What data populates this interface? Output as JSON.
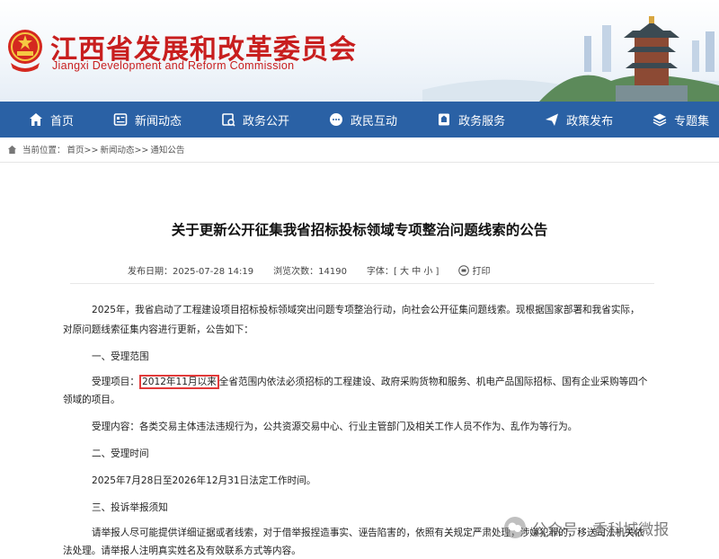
{
  "header": {
    "title": "江西省发展和改革委员会",
    "subtitle": "Jiangxi Development and Reform Commission"
  },
  "nav": [
    {
      "label": "首页",
      "icon": "home-icon"
    },
    {
      "label": "新闻动态",
      "icon": "news-icon"
    },
    {
      "label": "政务公开",
      "icon": "document-icon"
    },
    {
      "label": "政民互动",
      "icon": "chat-icon"
    },
    {
      "label": "政务服务",
      "icon": "service-icon"
    },
    {
      "label": "政策发布",
      "icon": "send-icon"
    },
    {
      "label": "专题集",
      "icon": "layers-icon"
    }
  ],
  "breadcrumb": {
    "prefix": "当前位置：",
    "items": [
      "首页>>",
      "新闻动态>>",
      "通知公告"
    ]
  },
  "article": {
    "title": "关于更新公开征集我省招标投标领域专项整治问题线索的公告",
    "meta": {
      "date_label": "发布日期：",
      "date": "2025-07-28 14:19",
      "views_label": "浏览次数：",
      "views": "14190",
      "font_label": "字体：",
      "font_sizes": "[ 大 中 小 ]",
      "print": "打印"
    },
    "paragraphs": {
      "intro1": "2025年，我省启动了工程建设项目招标投标领域突出问题专项整治行动，向社会公开征集问题线索。现根据国家部署和我省实际，",
      "intro2": "对原问题线索征集内容进行更新，公告如下：",
      "h1": "一、受理范围",
      "scope_label": "受理项目：",
      "scope_highlight": "2012年11月以来",
      "scope_rest": "全省范围内依法必须招标的工程建设、政府采购货物和服务、机电产品国际招标、国有企业采购等四个",
      "scope_line2": "领域的项目。",
      "content": "受理内容：各类交易主体违法违规行为，公共资源交易中心、行业主管部门及相关工作人员不作为、乱作为等行为。",
      "h2": "二、受理时间",
      "time": "2025年7月28日至2026年12月31日法定工作时间。",
      "h3": "三、投诉举报须知",
      "notice1": "请举报人尽可能提供详细证据或者线索，对于借举报捏造事实、诬告陷害的，依照有关规定严肃处理，涉嫌犯罪的，移送司法机关依",
      "notice2": "法处理。请举报人注明真实姓名及有效联系方式等内容。"
    }
  },
  "watermark": "公众号 · 香科城微报",
  "colors": {
    "brand_red": "#c81e1e",
    "nav_blue": "#2a61a5",
    "highlight": "#e23a3a"
  }
}
